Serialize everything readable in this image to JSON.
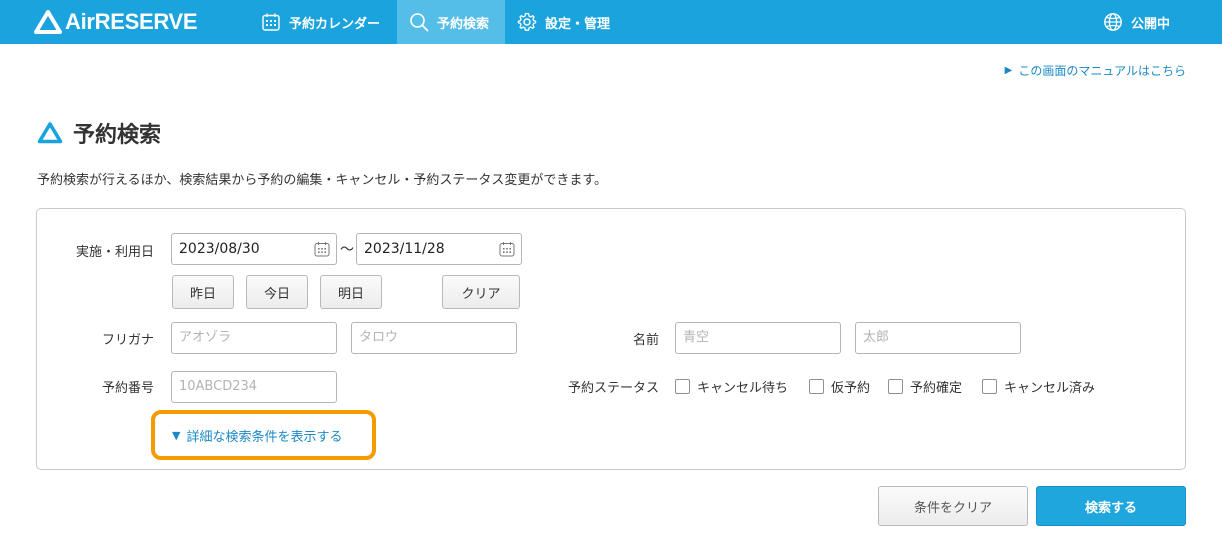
{
  "header": {
    "logo_text": "AirRESERVE",
    "nav": {
      "calendar": "予約カレンダー",
      "search": "予約検索",
      "settings": "設定・管理",
      "public": "公開中"
    }
  },
  "manual_link": "この画面のマニュアルはこちら",
  "page": {
    "title": "予約検索",
    "description": "予約検索が行えるほか、検索結果から予約の編集・キャンセル・予約ステータス変更ができます。"
  },
  "form": {
    "date_label": "実施・利用日",
    "date_from": "2023/08/30",
    "date_to": "2023/11/28",
    "tilde": "〜",
    "date_buttons": {
      "yesterday": "昨日",
      "today": "今日",
      "tomorrow": "明日",
      "clear": "クリア"
    },
    "furigana_label": "フリガナ",
    "furigana_last_placeholder": "アオゾラ",
    "furigana_first_placeholder": "タロウ",
    "name_label": "名前",
    "name_last_placeholder": "青空",
    "name_first_placeholder": "太郎",
    "reservation_number_label": "予約番号",
    "reservation_number_placeholder": "10ABCD234",
    "status_label": "予約ステータス",
    "status_options": [
      "キャンセル待ち",
      "仮予約",
      "予約確定",
      "キャンセル済み"
    ],
    "advanced_toggle": "詳細な検索条件を表示する"
  },
  "actions": {
    "clear": "条件をクリア",
    "search": "検索する"
  },
  "colors": {
    "header_bg": "#1aa3dc",
    "accent": "#1aa3dc",
    "highlight": "#f59b00"
  }
}
